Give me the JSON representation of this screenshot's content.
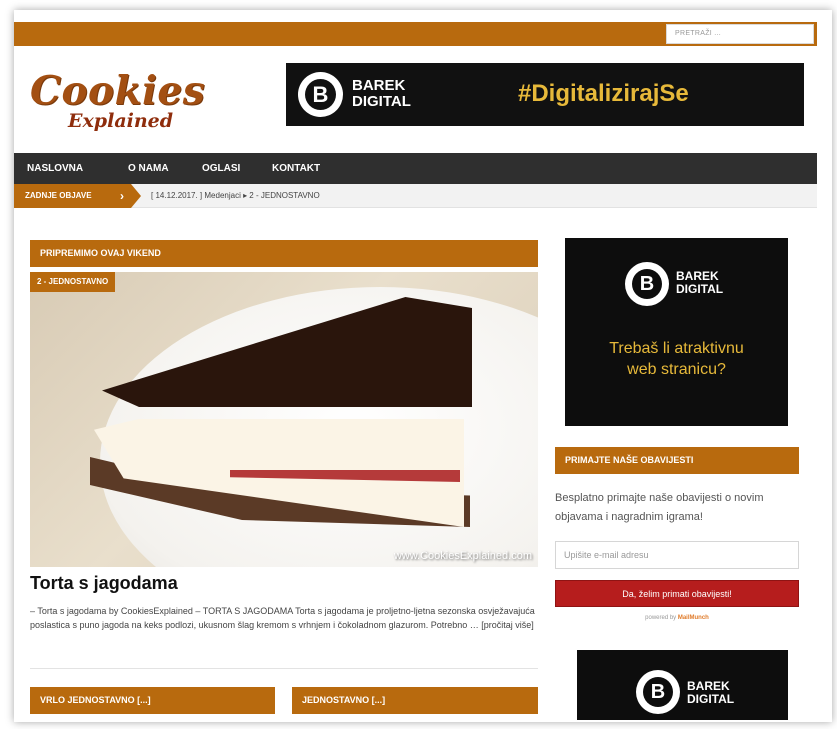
{
  "colors": {
    "accent": "#b86a0e",
    "nav_bg": "#2f2f2f",
    "ad_bg": "#111111",
    "ad_yellow": "#e7b93a",
    "button_red": "#b61d1d"
  },
  "header": {
    "search_placeholder": "PRETRAŽI ...",
    "logo_line1": "Cookies",
    "logo_line2": "Explained",
    "banner": {
      "brand_line1": "BAREK",
      "brand_line2": "DIGITAL",
      "tagline": "#DigitalizirajSe",
      "logo_letter": "B"
    }
  },
  "nav": {
    "items": [
      "NASLOVNA",
      "O NAMA",
      "OGLASI",
      "KONTAKT"
    ]
  },
  "ticker": {
    "label": "ZADNJE OBJAVE",
    "text": "[ 14.12.2017. ]  Medenjaci  ▸  2 - JEDNOSTAVNO"
  },
  "main": {
    "section_title": "PRIPREMIMO OVAJ VIKEND",
    "featured": {
      "category": "2 - JEDNOSTAVNO",
      "watermark": "www.CookiesExplained.com",
      "title": "Torta s jagodama",
      "excerpt": "– Torta s jagodama by CookiesExplained –   TORTA S JAGODAMA   Torta s jagodama je proljetno-ljetna sezonska osvježavajuća poslastica s puno jagoda na keks podlozi, ukusnom šlag kremom s vrhnjem i čokoladnom glazurom.   Potrebno … [pročitaj više]"
    },
    "bottom_sections": [
      "VRLO JEDNOSTAVNO [...]",
      "JEDNOSTAVNO [...]"
    ]
  },
  "sidebar": {
    "ad1": {
      "brand_line1": "BAREK",
      "brand_line2": "DIGITAL",
      "cta_line1": "Trebaš li atraktivnu",
      "cta_line2": "web stranicu?",
      "logo_letter": "B"
    },
    "newsletter": {
      "title": "PRIMAJTE NAŠE OBAVIJESTI",
      "text": "Besplatno primajte naše obavijesti o novim objavama i nagradnim igrama!",
      "email_placeholder": "Upišite e-mail adresu",
      "button_label": "Da, želim primati obavijesti!",
      "powered_prefix": "powered by",
      "powered_brand": "MailMunch"
    },
    "ad2": {
      "brand_line1": "BAREK",
      "brand_line2": "DIGITAL",
      "logo_letter": "B"
    }
  }
}
